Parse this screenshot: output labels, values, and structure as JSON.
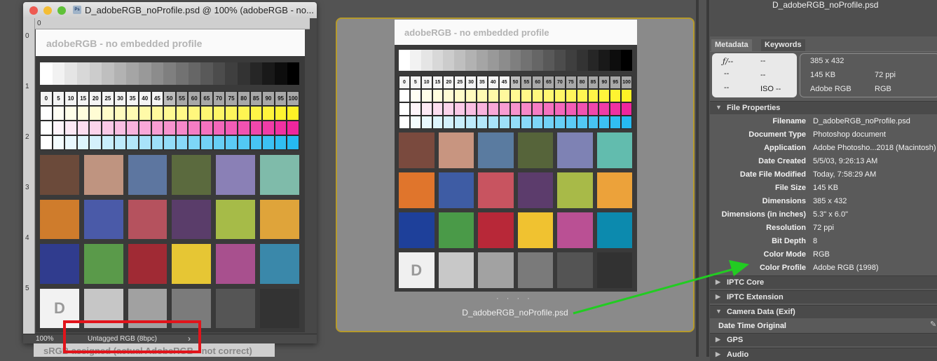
{
  "document_window": {
    "title": "D_adobeRGB_noProfile.psd @ 100% (adobeRGB - no...",
    "zoom": "100%",
    "profile_status": "Untagged RGB (8bpc)",
    "ruler_top": [
      "0"
    ],
    "ruler_left": [
      "0",
      "1",
      "2",
      "3",
      "4",
      "5"
    ]
  },
  "target": {
    "title": "adobeRGB - no embedded profile",
    "tint_labels": [
      "0",
      "5",
      "10",
      "15",
      "20",
      "25",
      "30",
      "35",
      "40",
      "45",
      "50",
      "55",
      "60",
      "65",
      "70",
      "75",
      "80",
      "85",
      "90",
      "95",
      "100"
    ],
    "patch_letter": "D"
  },
  "background_window": {
    "title": "sRGB assigned (actual AdobeRGB - not correct)"
  },
  "bridge": {
    "filename": "D_adobeRGB_noProfile.psd"
  },
  "metadata_panel": {
    "top_filename": "D_adobeRGB_noProfile.psd",
    "tabs": [
      "Metadata",
      "Keywords"
    ],
    "camera": {
      "aperture": "ƒ/--",
      "shutter": "--",
      "exposure": "--",
      "ev": "--",
      "metering": "--",
      "iso": "ISO --"
    },
    "summary": {
      "dimensions": "385 x 432",
      "size": "145 KB",
      "resolution": "72 ppi",
      "color_profile": "Adobe RGB",
      "mode": "RGB"
    },
    "sections": {
      "file_properties": "File Properties",
      "iptc_core": "IPTC Core",
      "iptc_extension": "IPTC Extension",
      "camera_data": "Camera Data (Exif)",
      "date_time_original": "Date Time Original",
      "gps": "GPS",
      "audio": "Audio"
    },
    "file_properties": [
      {
        "label": "Filename",
        "value": "D_adobeRGB_noProfile.psd"
      },
      {
        "label": "Document Type",
        "value": "Photoshop document"
      },
      {
        "label": "Application",
        "value": "Adobe Photosho...2018 (Macintosh)"
      },
      {
        "label": "Date Created",
        "value": "5/5/03, 9:26:13 AM"
      },
      {
        "label": "Date File Modified",
        "value": "Today, 7:58:29 AM"
      },
      {
        "label": "File Size",
        "value": "145 KB"
      },
      {
        "label": "Dimensions",
        "value": "385 x 432"
      },
      {
        "label": "Dimensions (in inches)",
        "value": "5.3\" x 6.0\""
      },
      {
        "label": "Resolution",
        "value": "72 ppi"
      },
      {
        "label": "Bit Depth",
        "value": "8"
      },
      {
        "label": "Color Mode",
        "value": "RGB"
      },
      {
        "label": "Color Profile",
        "value": "Adobe RGB (1998)"
      }
    ]
  },
  "colors": {
    "highlight": "#e1141b",
    "arrow": "#22cc22",
    "bridge_border": "#b59a2c",
    "patches_left": [
      "#6b4a3a",
      "#bf9480",
      "#5d76a0",
      "#5b6a3e",
      "#8a80b6",
      "#7fbbaa",
      "#cf7c2c",
      "#4a5aa8",
      "#b5525e",
      "#5a3d6a",
      "#a6bb48",
      "#dfa43a",
      "#303c8e",
      "#5a9a4a",
      "#a02a34",
      "#e6c634",
      "#a8508e",
      "#3a88aa",
      "#f2f2f2",
      "#c6c6c6",
      "#a1a1a1",
      "#7b7b7b",
      "#555555",
      "#333333"
    ],
    "patches_right": [
      "#7a4a3e",
      "#c89580",
      "#5a7ba0",
      "#56643a",
      "#7e82b4",
      "#62bcae",
      "#e0752c",
      "#3e5ca4",
      "#c85460",
      "#5c3c6c",
      "#a8ba48",
      "#eca23a",
      "#1e409a",
      "#4a9a48",
      "#b82838",
      "#f0c230",
      "#ba5094",
      "#0c8aae",
      "#f0f0f0",
      "#c8c8c8",
      "#a2a2a2",
      "#7a7a7a",
      "#545454",
      "#323232"
    ]
  }
}
